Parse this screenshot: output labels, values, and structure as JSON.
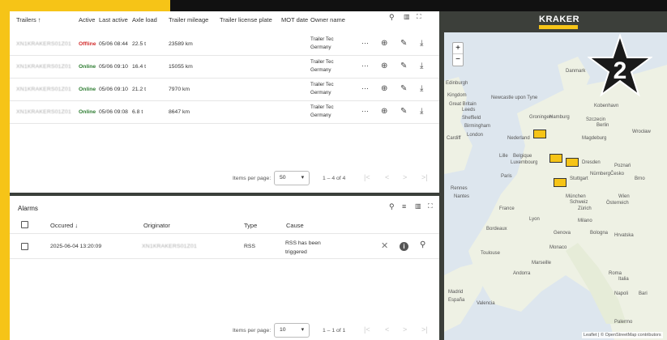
{
  "trailers": {
    "columns": [
      "Trailers ↑",
      "Active",
      "Last active",
      "Axle load",
      "Trailer mileage",
      "Trailer license plate",
      "MOT date",
      "Owner name"
    ],
    "rows": [
      {
        "id": "XN1KRAKERS01Z01",
        "status": "Offline",
        "last_active": "05/06 08:44",
        "axle": "22.5 t",
        "mileage": "23589 km",
        "owner": "Trailer Tec Germany"
      },
      {
        "id": "XN1KRAKERS01Z01",
        "status": "Online",
        "last_active": "05/06 09:10",
        "axle": "16.4 t",
        "mileage": "15055 km",
        "owner": "Trailer Tec Germany"
      },
      {
        "id": "XN1KRAKERS01Z01",
        "status": "Online",
        "last_active": "05/06 09:10",
        "axle": "21.2 t",
        "mileage": "7970 km",
        "owner": "Trailer Tec Germany"
      },
      {
        "id": "XN1KRAKERS01Z01",
        "status": "Online",
        "last_active": "05/06 09:08",
        "axle": "6.8 t",
        "mileage": "8647 km",
        "owner": "Trailer Tec Germany"
      }
    ],
    "pager": {
      "label": "Items per page:",
      "per_page": "50",
      "range": "1 – 4 of 4"
    }
  },
  "alarms": {
    "title": "Alarms",
    "columns": [
      "Occured ↓",
      "Originator",
      "Type",
      "Cause"
    ],
    "rows": [
      {
        "time": "2025-06-04 13:20:09",
        "originator": "XN1KRAKERS01Z01",
        "type": "RSS",
        "cause": "RSS has been triggered"
      }
    ],
    "pager": {
      "label": "Items per page:",
      "per_page": "10",
      "range": "1 – 1 of 1"
    }
  },
  "map": {
    "brand": "KRAKER",
    "badge": "2",
    "zoom_in": "+",
    "zoom_out": "−",
    "attribution": "Leaflet | © OpenStreetMap contributors",
    "labels": [
      "Danmark",
      "Edinburgh",
      "Kingdom",
      "Newcastle upon Tyne",
      "Great Britain",
      "Leeds",
      "Sheffield",
      "Birmingham",
      "London",
      "Cardiff",
      "Groningen",
      "Hamburg",
      "Szczecin",
      "Berlin",
      "Nederland",
      "Magdeburg",
      "Dresden",
      "Poznań",
      "Lille",
      "Belgique",
      "Luxembourg",
      "Nürnberg",
      "Česko",
      "Brno",
      "Paris",
      "Stuttgart",
      "München",
      "Rennes",
      "Nantes",
      "France",
      "Schweiz",
      "Wien",
      "Österreich",
      "Milano",
      "Bordeaux",
      "Genova",
      "Bologna",
      "Hrvatska",
      "Monaco",
      "Marseille",
      "Andorra",
      "Roma",
      "Italia",
      "Madrid",
      "España",
      "Valencia",
      "Napoli",
      "Bari",
      "Palermo",
      "Kobenhavn",
      "Wrocław",
      "Zürich",
      "Lyon",
      "Toulouse"
    ]
  }
}
